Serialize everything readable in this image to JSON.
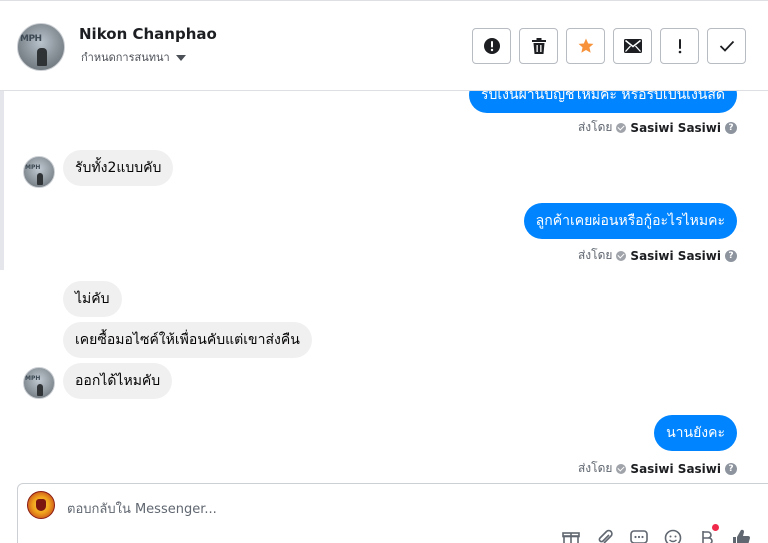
{
  "header": {
    "name": "Nikon Chanphao",
    "subtitle": "กำหนดการสนทนา",
    "avatar_text": "MPH"
  },
  "actions": [
    {
      "name": "report-button",
      "icon": "alert-circle-icon"
    },
    {
      "name": "delete-button",
      "icon": "trash-icon"
    },
    {
      "name": "star-button",
      "icon": "star-icon",
      "color": "#f7923b"
    },
    {
      "name": "mail-button",
      "icon": "envelope-icon"
    },
    {
      "name": "important-button",
      "icon": "exclamation-icon"
    },
    {
      "name": "done-button",
      "icon": "checkmark-icon"
    }
  ],
  "messages": {
    "m1": "รับเงินผ่านบัญชีไหมคะ หรือรับเป็นเงินสด",
    "m2": "รับทั้ง2แบบคับ",
    "m3": "ลูกค้าเคยผ่อนหรือกู้อะไรไหมคะ",
    "m4": "ไม่คับ",
    "m5": "เคยซื้อมอไซค์ให้เพื่อนคับแต่เขาส่งคืน",
    "m6": "ออกได้ไหมคับ",
    "m7": "นานยังคะ"
  },
  "sent_by": {
    "label": "ส่งโดย",
    "who": "Sasiwi Sasiwi",
    "help": "?"
  },
  "composer": {
    "placeholder": "ตอบกลับใน Messenger...",
    "tools": [
      "gift-icon",
      "paperclip-icon",
      "saved-replies-icon",
      "emoji-icon",
      "payment-icon",
      "like-icon"
    ]
  },
  "colors": {
    "accent": "#0084ff",
    "incoming": "#f1f0f0",
    "star": "#f7923b",
    "notification_dot": "#f02849"
  }
}
